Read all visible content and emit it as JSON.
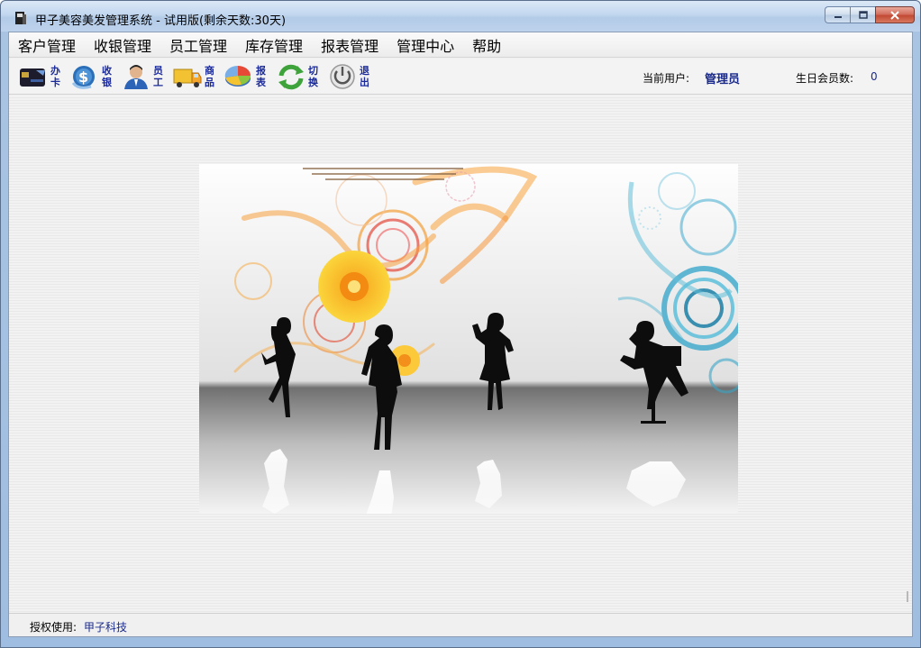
{
  "window": {
    "title": "甲子美容美发管理系统 - 试用版(剩余天数:30天)",
    "controls": {
      "minimize_icon": "minimize-icon",
      "maximize_icon": "maximize-icon",
      "close_icon": "close-icon"
    }
  },
  "menu": {
    "items": [
      {
        "label": "客户管理"
      },
      {
        "label": "收银管理"
      },
      {
        "label": "员工管理"
      },
      {
        "label": "库存管理"
      },
      {
        "label": "报表管理"
      },
      {
        "label": "管理中心"
      },
      {
        "label": "帮助"
      }
    ]
  },
  "toolbar": {
    "buttons": [
      {
        "line1": "办",
        "line2": "卡",
        "icon": "membership-card-icon"
      },
      {
        "line1": "收",
        "line2": "银",
        "icon": "cashier-icon"
      },
      {
        "line1": "员",
        "line2": "工",
        "icon": "employee-icon"
      },
      {
        "line1": "商",
        "line2": "品",
        "icon": "goods-truck-icon"
      },
      {
        "line1": "报",
        "line2": "表",
        "icon": "report-pie-icon"
      },
      {
        "line1": "切",
        "line2": "换",
        "icon": "switch-icon"
      },
      {
        "line1": "退",
        "line2": "出",
        "icon": "exit-power-icon"
      }
    ],
    "current_user_label": "当前用户:",
    "current_user_value": "管理员",
    "birthday_label": "生日会员数:",
    "birthday_value": "0"
  },
  "status": {
    "license_label": "授权使用:",
    "license_value": "甲子科技"
  },
  "colors": {
    "accent_text": "#1a2a8c",
    "title_gradient": "#c2d7ef",
    "close_button": "#c24a34"
  }
}
